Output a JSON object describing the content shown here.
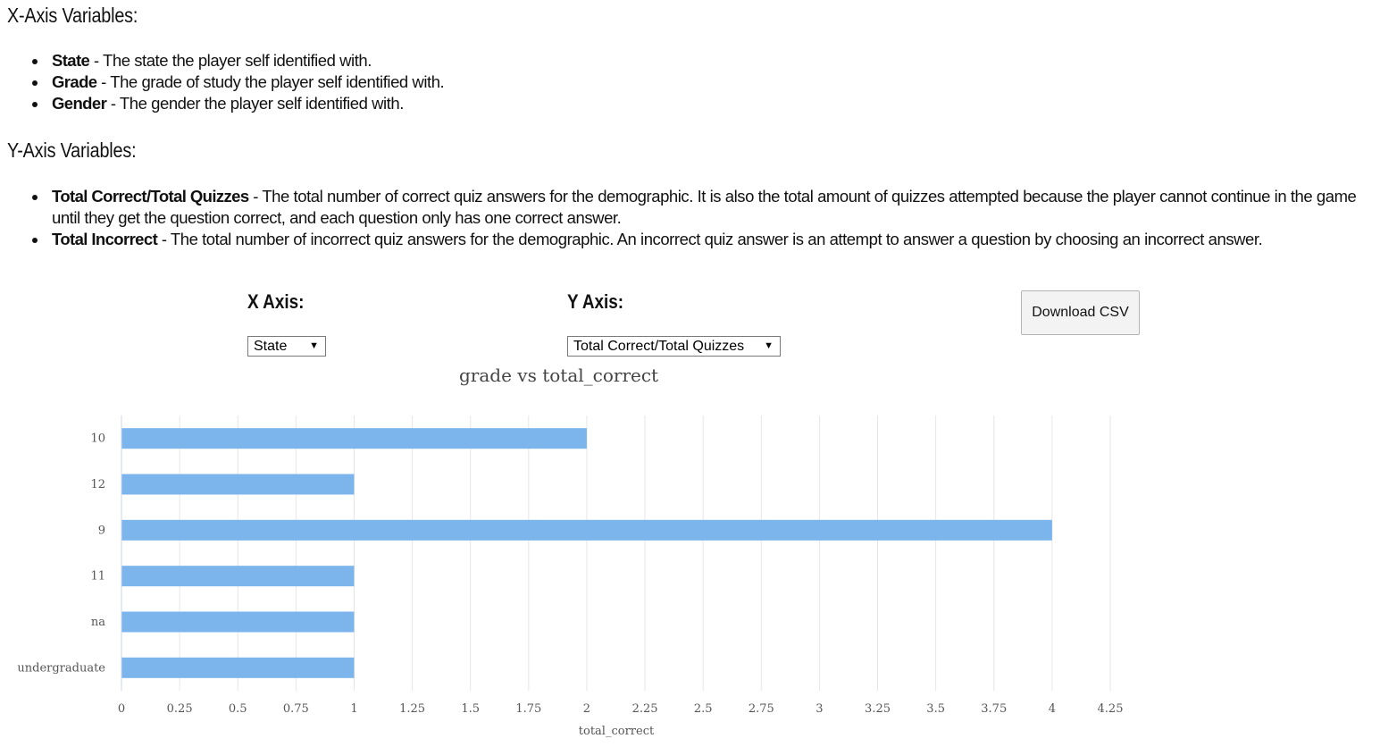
{
  "x_axis_section": {
    "heading": "X-Axis Variables:",
    "items": [
      {
        "term": "State",
        "desc": " - The state the player self identified with."
      },
      {
        "term": "Grade",
        "desc": " - The grade of study the player self identified with."
      },
      {
        "term": "Gender",
        "desc": " - The gender the player self identified with."
      }
    ]
  },
  "y_axis_section": {
    "heading": "Y-Axis Variables:",
    "items": [
      {
        "term": "Total Correct/Total Quizzes",
        "desc": " - The total number of correct quiz answers for the demographic. It is also the total amount of quizzes attempted because the player cannot continue in the game until they get the question correct, and each question only has one correct answer."
      },
      {
        "term": "Total Incorrect",
        "desc": " - The total number of incorrect quiz answers for the demographic. An incorrect quiz answer is an attempt to answer a question by choosing an incorrect answer."
      }
    ]
  },
  "controls": {
    "x_label": "X Axis:",
    "x_selected": "State",
    "y_label": "Y Axis:",
    "y_selected": "Total Correct/Total Quizzes",
    "download_label": "Download CSV"
  },
  "chart_data": {
    "type": "bar",
    "orientation": "horizontal",
    "title": "grade vs total_correct",
    "xlabel": "total_correct",
    "ylabel": "",
    "categories": [
      "10",
      "12",
      "9",
      "11",
      "na",
      "undergraduate"
    ],
    "values": [
      2,
      1,
      4,
      1,
      1,
      1
    ],
    "xlim": [
      0,
      4.25
    ],
    "ticks": [
      "0",
      "0.25",
      "0.5",
      "0.75",
      "1",
      "1.25",
      "1.5",
      "1.75",
      "2",
      "2.25",
      "2.5",
      "2.75",
      "3",
      "3.25",
      "3.5",
      "3.75",
      "4",
      "4.25"
    ],
    "grid": true,
    "bar_color": "#7cb5ec"
  }
}
